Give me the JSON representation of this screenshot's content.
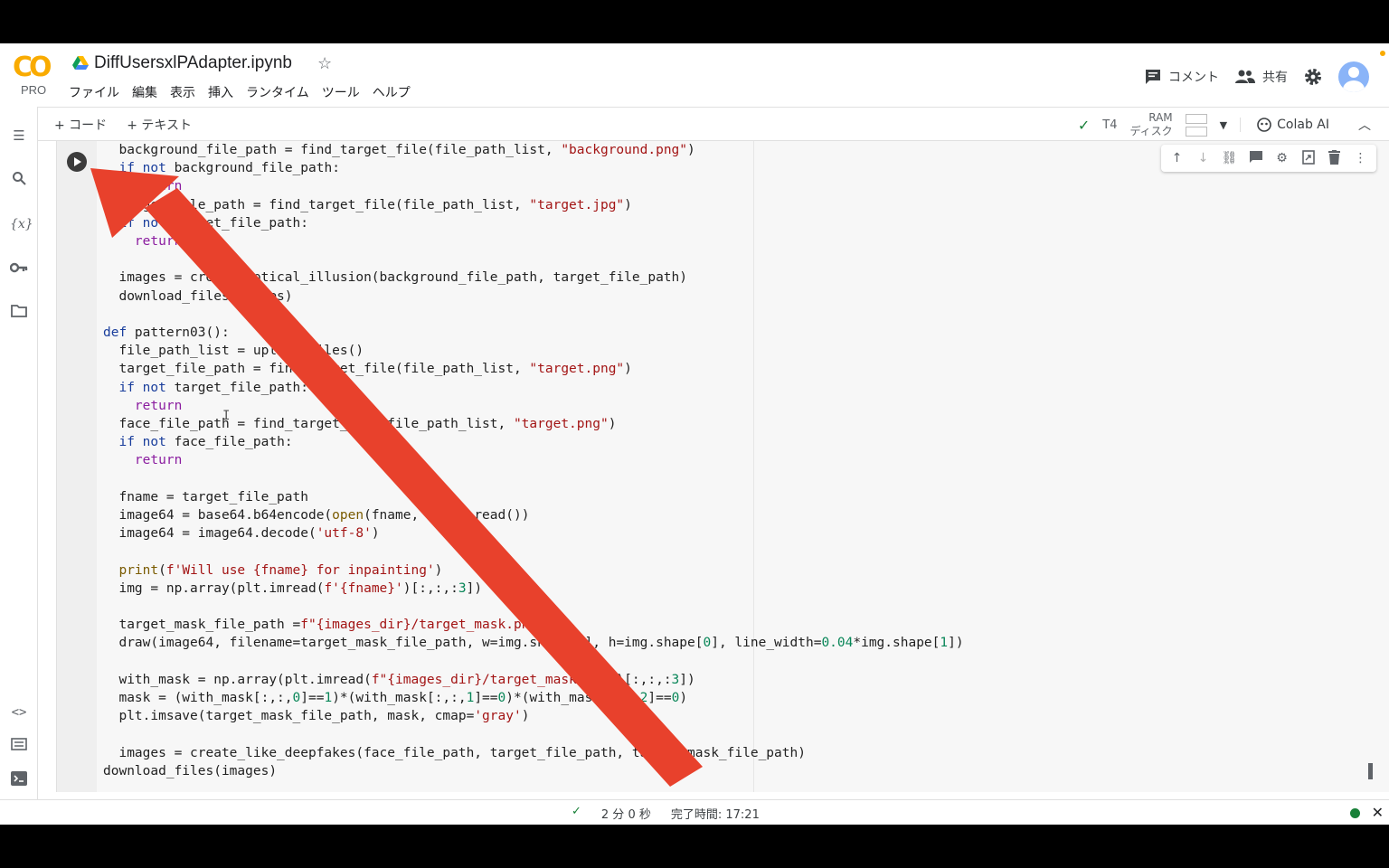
{
  "header": {
    "logo_text": "CO",
    "logo_pro": "PRO",
    "notebook_title": "DiffUsersxlPAdapter.ipynb",
    "menu": [
      "ファイル",
      "編集",
      "表示",
      "挿入",
      "ランタイム",
      "ツール",
      "ヘルプ"
    ],
    "comment_label": "コメント",
    "share_label": "共有"
  },
  "toolbar": {
    "add_code": "+ コード",
    "add_text": "+ テキスト",
    "runtime": "T4",
    "ram_label": "RAM",
    "disk_label": "ディスク",
    "colab_ai": "Colab AI"
  },
  "cell": {
    "lines": [
      "  background_file_path = find_target_file(file_path_list, \"background.png\")",
      "  if not background_file_path:",
      "    return",
      "  target_file_path = find_target_file(file_path_list, \"target.jpg\")",
      "  if not target_file_path:",
      "    return",
      "",
      "  images = create_optical_illusion(background_file_path, target_file_path)",
      "  download_files(images)",
      "",
      "def pattern03():",
      "  file_path_list = upload_files()",
      "  target_file_path = find_target_file(file_path_list, \"target.png\")",
      "  if not target_file_path:",
      "    return",
      "  face_file_path = find_target_file(file_path_list, \"target.png\")",
      "  if not face_file_path:",
      "    return",
      "",
      "  fname = target_file_path",
      "  image64 = base64.b64encode(open(fname, 'rb').read())",
      "  image64 = image64.decode('utf-8')",
      "",
      "  print(f'Will use {fname} for inpainting')",
      "  img = np.array(plt.imread(f'{fname}')[:,:,:3])",
      "",
      "  target_mask_file_path =f\"{images_dir}/target_mask.png\"",
      "  draw(image64, filename=target_mask_file_path, w=img.shape[1], h=img.shape[0], line_width=0.04*img.shape[1])",
      "",
      "  with_mask = np.array(plt.imread(f\"{images_dir}/target_mask.png\")[:,:,:3])",
      "  mask = (with_mask[:,:,0]==1)*(with_mask[:,:,1]==0)*(with_mask[:,:,2]==0)",
      "  plt.imsave(target_mask_file_path, mask, cmap='gray')",
      "",
      "  images = create_like_deepfakes(face_file_path, target_file_path, target_mask_file_path)",
      "download_files(images)"
    ]
  },
  "status": {
    "duration": "2 分 0 秒",
    "completed": "完了時間: 17:21"
  },
  "icons": {
    "sidebar": [
      "toc-icon",
      "search-icon",
      "variables-icon",
      "key-icon",
      "folder-icon",
      "code-snippets-icon",
      "command-palette-icon",
      "terminal-icon"
    ],
    "cell_toolbar": [
      "move-up-icon",
      "move-down-icon",
      "link-icon",
      "comment-icon",
      "settings-icon",
      "mirror-cell-icon",
      "delete-icon",
      "more-icon"
    ]
  },
  "colors": {
    "arrow": "#e8412c",
    "logo": "#f9ab00",
    "status_ok": "#188038"
  }
}
